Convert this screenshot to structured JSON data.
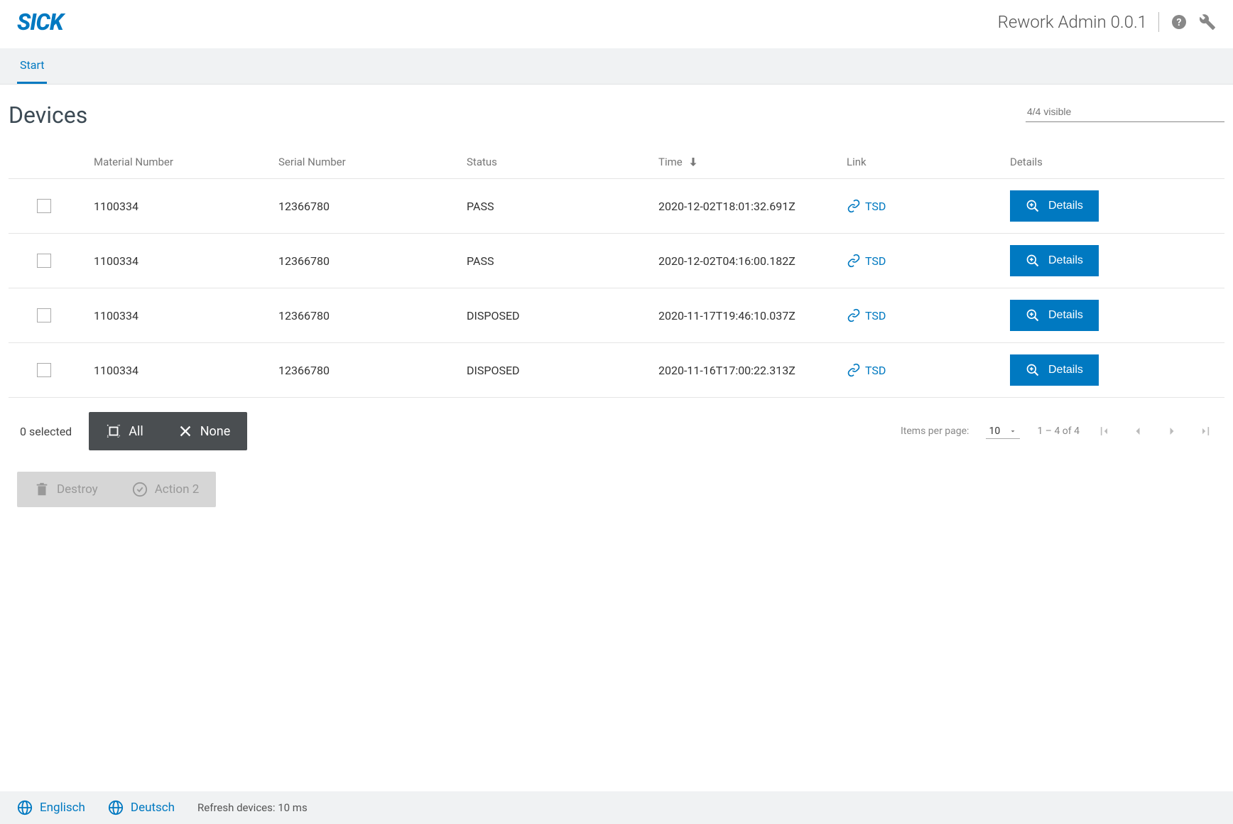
{
  "header": {
    "logo": "SICK",
    "app_title": "Rework Admin 0.0.1"
  },
  "tabs": {
    "start": "Start"
  },
  "page": {
    "title": "Devices",
    "filter_placeholder": "4/4 visible"
  },
  "columns": {
    "material": "Material Number",
    "serial": "Serial Number",
    "status": "Status",
    "time": "Time",
    "link": "Link",
    "details": "Details"
  },
  "rows": [
    {
      "material": "1100334",
      "serial": "12366780",
      "status": "PASS",
      "time": "2020-12-02T18:01:32.691Z",
      "link": "TSD",
      "details": "Details"
    },
    {
      "material": "1100334",
      "serial": "12366780",
      "status": "PASS",
      "time": "2020-12-02T04:16:00.182Z",
      "link": "TSD",
      "details": "Details"
    },
    {
      "material": "1100334",
      "serial": "12366780",
      "status": "DISPOSED",
      "time": "2020-11-17T19:46:10.037Z",
      "link": "TSD",
      "details": "Details"
    },
    {
      "material": "1100334",
      "serial": "12366780",
      "status": "DISPOSED",
      "time": "2020-11-16T17:00:22.313Z",
      "link": "TSD",
      "details": "Details"
    }
  ],
  "selection": {
    "count": "0 selected",
    "all": "All",
    "none": "None"
  },
  "pagination": {
    "items_label": "Items per page:",
    "per_page": "10",
    "range": "1 – 4 of 4"
  },
  "actions": {
    "destroy": "Destroy",
    "action2": "Action 2"
  },
  "footer": {
    "lang_en": "Englisch",
    "lang_de": "Deutsch",
    "refresh": "Refresh devices: 10 ms"
  }
}
